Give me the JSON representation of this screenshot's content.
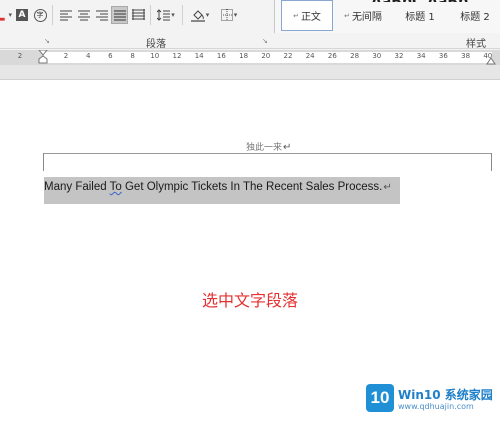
{
  "ribbon": {
    "paragraph_group_label": "段落",
    "styles_group_label": "样式",
    "styles": [
      {
        "label": "正文",
        "marker": "↵",
        "active": true
      },
      {
        "label": "无间隔",
        "marker": "↵",
        "active": false
      },
      {
        "label": "标题 1",
        "marker": "",
        "active": false
      },
      {
        "label": "标题 2",
        "marker": "",
        "active": false
      }
    ],
    "font_buttons": {
      "char_border": "A",
      "enclose_char": "字"
    },
    "dialog_launcher": "↘",
    "colors": {
      "ribbon_bg": "#f3f3f3",
      "active_style_border": "#8aa7d1"
    }
  },
  "ruler": {
    "numbers": [
      "2",
      "2",
      "4",
      "6",
      "8",
      "10",
      "12",
      "14",
      "16",
      "18",
      "20",
      "22",
      "24",
      "26",
      "28",
      "30",
      "32",
      "34",
      "36",
      "38",
      "40"
    ]
  },
  "document": {
    "header_text": "独此一来",
    "header_mark": "↵",
    "paragraph": {
      "before": "Many Failed ",
      "flagged_word": "To",
      "after": " Get Olympic Tickets In The Recent Sales Process.",
      "mark": "↵"
    },
    "selection_color": "#c4c4c4"
  },
  "annotation": {
    "caption": "选中文字段落",
    "color": "#e53030"
  },
  "watermark": {
    "logo": "10",
    "title": "Win10 系统家园",
    "url": "www.qdhuajin.com"
  }
}
